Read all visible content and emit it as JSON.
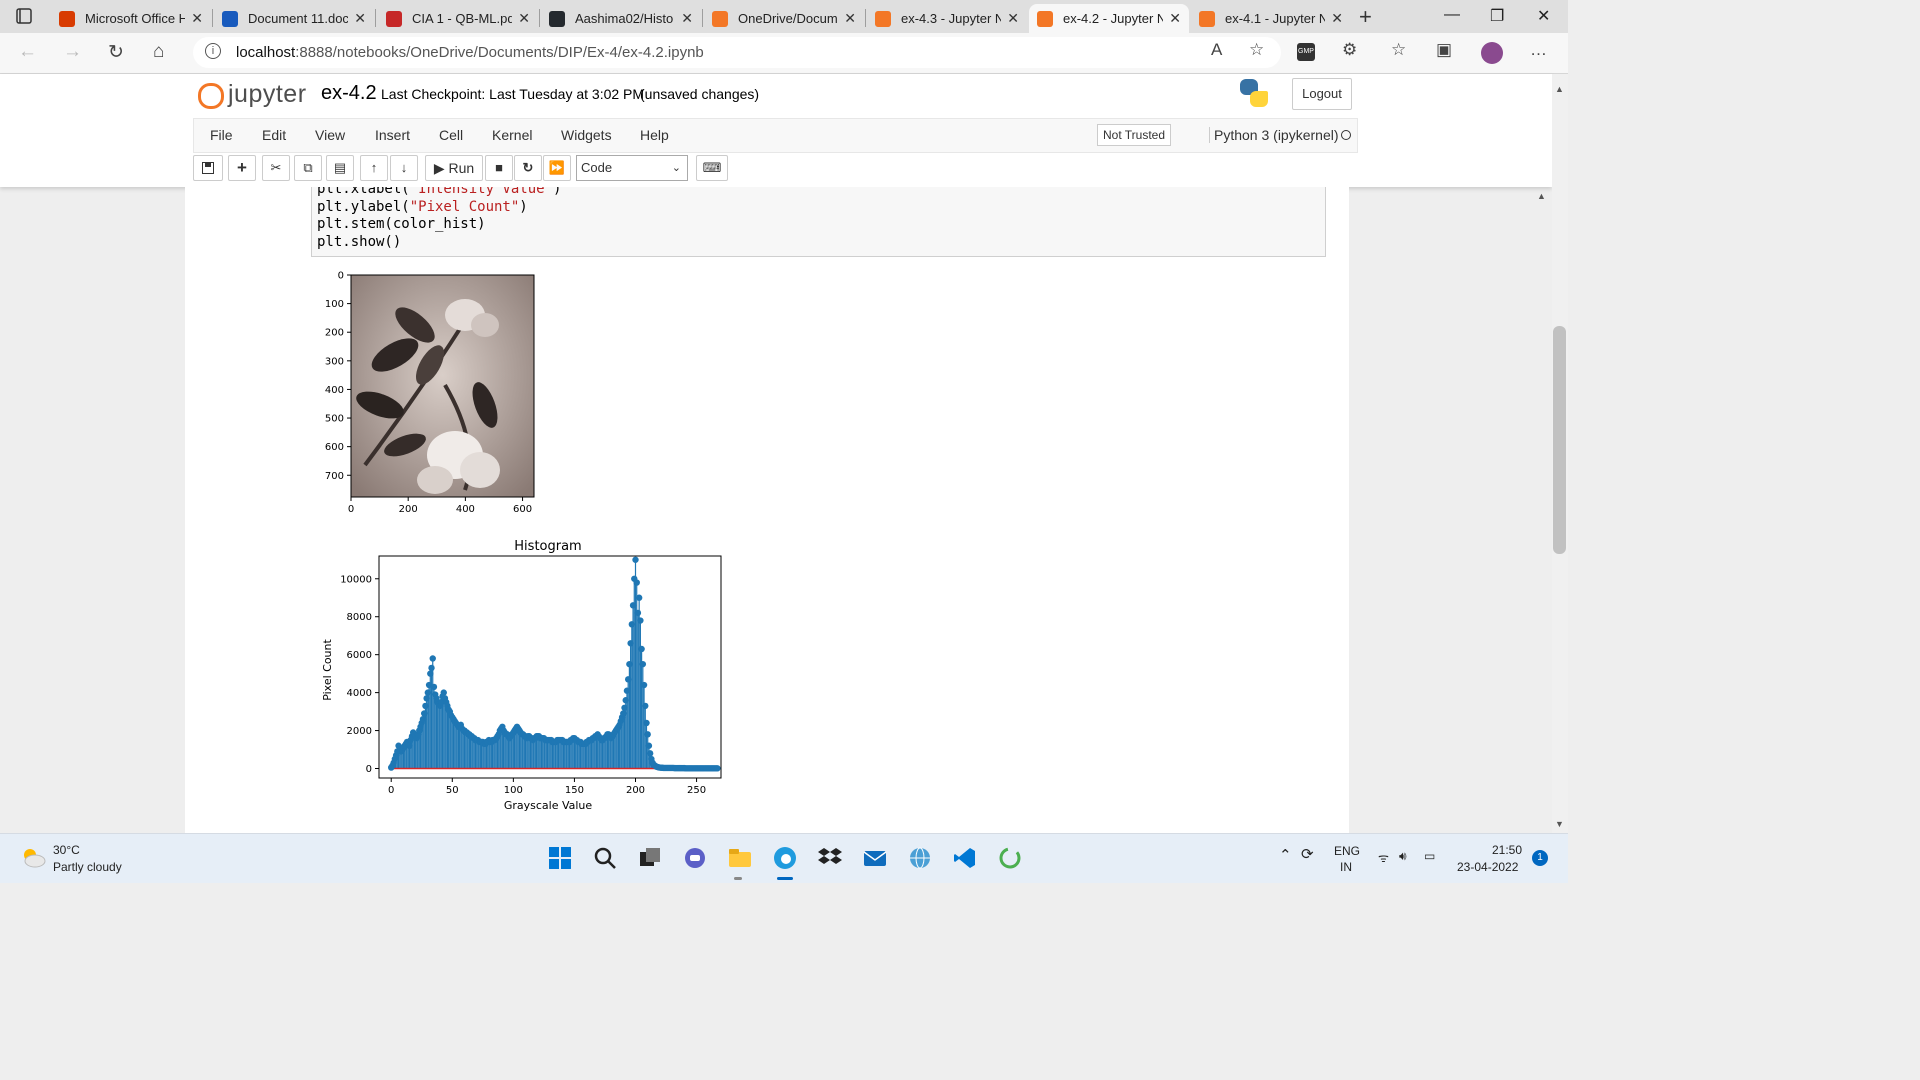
{
  "browser": {
    "tabs": [
      {
        "label": "Microsoft Office H",
        "icon": "office-icon",
        "color": "#d83b01"
      },
      {
        "label": "Document 11.doc",
        "icon": "word-icon",
        "color": "#185abd"
      },
      {
        "label": "CIA 1 - QB-ML.pd",
        "icon": "pdf-icon",
        "color": "#c62828"
      },
      {
        "label": "Aashima02/Histo",
        "icon": "github-icon",
        "color": "#24292e"
      },
      {
        "label": "OneDrive/Docum",
        "icon": "jupyter-icon",
        "color": "#f37726"
      },
      {
        "label": "ex-4.3 - Jupyter N",
        "icon": "notebook-icon",
        "color": "#f37726"
      },
      {
        "label": "ex-4.2 - Jupyter N",
        "icon": "notebook-icon",
        "color": "#f37726"
      },
      {
        "label": "ex-4.1 - Jupyter N",
        "icon": "notebook-icon",
        "color": "#f37726"
      }
    ],
    "url_host": "localhost",
    "url_path": ":8888/notebooks/OneDrive/Documents/DIP/Ex-4/ex-4.2.ipynb"
  },
  "jupyter": {
    "logo_text": "jupyter",
    "notebook_name": "ex-4.2",
    "checkpoint": "Last Checkpoint: Last Tuesday at 3:02 PM",
    "unsaved": "(unsaved changes)",
    "logout": "Logout",
    "menu": [
      "File",
      "Edit",
      "View",
      "Insert",
      "Cell",
      "Kernel",
      "Widgets",
      "Help"
    ],
    "trust": "Not Trusted",
    "kernel": "Python 3 (ipykernel)",
    "run_label": "Run",
    "cell_type": "Code",
    "accent": "#f37726"
  },
  "code": {
    "lines": [
      {
        "pre": "plt.xlabel(",
        "str": "\"Intensity Value\"",
        "post": ")"
      },
      {
        "pre": "plt.ylabel(",
        "str": "\"Pixel Count\"",
        "post": ")"
      },
      {
        "pre": "plt.stem(color_hist)",
        "str": "",
        "post": ""
      },
      {
        "pre": "plt.show()",
        "str": "",
        "post": ""
      }
    ]
  },
  "outputs": {
    "image_plot": {
      "xticks": [
        "0",
        "200",
        "400",
        "600"
      ],
      "yticks": [
        "0",
        "100",
        "200",
        "300",
        "400",
        "500",
        "600",
        "700"
      ]
    }
  },
  "chart_data": {
    "type": "stem",
    "title": "Histogram",
    "xlabel": "Grayscale Value",
    "ylabel": "Pixel Count",
    "xlim": [
      -10,
      270
    ],
    "ylim": [
      -500,
      11200
    ],
    "xticks": [
      0,
      50,
      100,
      150,
      200,
      250
    ],
    "yticks": [
      0,
      2000,
      4000,
      6000,
      8000,
      10000
    ],
    "color": "#1f77b4",
    "baseline_color": "#d62728",
    "x_start": 0,
    "values": [
      50,
      150,
      300,
      500,
      700,
      900,
      1200,
      1000,
      900,
      1000,
      1100,
      1200,
      1300,
      1400,
      1300,
      1200,
      1500,
      1700,
      1900,
      1800,
      1700,
      1600,
      1800,
      2000,
      2200,
      2400,
      2600,
      2900,
      3300,
      3700,
      4000,
      4400,
      5000,
      5300,
      5800,
      4300,
      3900,
      3700,
      3500,
      3400,
      3300,
      3500,
      3800,
      4000,
      3700,
      3500,
      3300,
      3100,
      3000,
      2800,
      2700,
      2600,
      2500,
      2400,
      2300,
      2200,
      2200,
      2300,
      2100,
      2000,
      2000,
      1900,
      1900,
      1800,
      1800,
      1700,
      1700,
      1600,
      1600,
      1500,
      1500,
      1500,
      1400,
      1400,
      1400,
      1400,
      1300,
      1300,
      1400,
      1400,
      1500,
      1400,
      1400,
      1500,
      1500,
      1500,
      1600,
      1700,
      1800,
      2000,
      2100,
      2200,
      2000,
      1900,
      1800,
      1800,
      1700,
      1600,
      1700,
      1800,
      1900,
      2000,
      2100,
      2200,
      2100,
      2000,
      1900,
      1800,
      1800,
      1700,
      1700,
      1600,
      1700,
      1700,
      1600,
      1600,
      1500,
      1600,
      1600,
      1700,
      1700,
      1700,
      1600,
      1600,
      1600,
      1600,
      1500,
      1500,
      1500,
      1500,
      1500,
      1500,
      1400,
      1400,
      1400,
      1400,
      1500,
      1500,
      1500,
      1500,
      1500,
      1400,
      1400,
      1400,
      1400,
      1400,
      1400,
      1500,
      1500,
      1600,
      1600,
      1500,
      1500,
      1400,
      1400,
      1400,
      1300,
      1300,
      1300,
      1300,
      1400,
      1400,
      1500,
      1500,
      1500,
      1600,
      1600,
      1700,
      1700,
      1800,
      1700,
      1600,
      1500,
      1500,
      1600,
      1600,
      1700,
      1800,
      1800,
      1700,
      1600,
      1700,
      1800,
      1900,
      2000,
      2100,
      2200,
      2300,
      2500,
      2700,
      2900,
      3200,
      3600,
      4100,
      4700,
      5500,
      6600,
      7600,
      8600,
      10000,
      11000,
      9800,
      8200,
      9000,
      7800,
      6300,
      5500,
      4400,
      3300,
      2400,
      1800,
      1200,
      800,
      500,
      300,
      200,
      150,
      100,
      80,
      60,
      50,
      40,
      40,
      30,
      30,
      30,
      30,
      30,
      30,
      30,
      30,
      30,
      20,
      20,
      20,
      20,
      20,
      20,
      20,
      20,
      20,
      10,
      10,
      10,
      10,
      10,
      10,
      10,
      10,
      10,
      10,
      10,
      10,
      10,
      10,
      10,
      10,
      10,
      10,
      10,
      10,
      10,
      10,
      10,
      10,
      10,
      10,
      10
    ]
  },
  "taskbar": {
    "temp": "30°C",
    "weather": "Partly cloudy",
    "lang1": "ENG",
    "lang2": "IN",
    "time": "21:50",
    "date": "23-04-2022",
    "notifications": "1",
    "accent": "#0067c0"
  }
}
